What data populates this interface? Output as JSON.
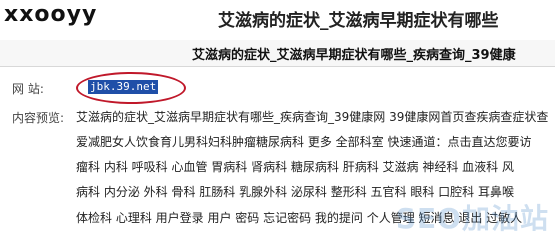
{
  "header": {
    "logo": "xxooyy",
    "title": "艾滋病的症状_艾滋病早期症状有哪些"
  },
  "result": {
    "title": "艾滋病的症状_艾滋病早期症状有哪些_疾病查询_39健康",
    "site_label": "网      站:",
    "site_value": "jbk.39.net",
    "preview_label": "内容预览:",
    "preview_lines": [
      "艾滋病的症状_艾滋病早期症状有哪些_疾病查询_39健康网 39健康网首页查疾病查症状查",
      "爱减肥女人饮食育儿男科妇科肿瘤糖尿病科 更多 全部科室 快速通道：点击直达您要访",
      "瘤科 内科 呼吸科 心血管 胃病科 肾病科 糖尿病科 肝病科 艾滋病 神经科 血液科 风",
      "病科 内分泌 外科 骨科 肛肠科 乳腺外科 泌尿科 整形科 五官科 眼科 口腔科 耳鼻喉",
      "体检科 心理科 用户登录 用户 密码 忘记密码 我的提问 个人管理 短消息 退出 过敏人"
    ]
  },
  "watermark": "SEO加油站",
  "colors": {
    "highlight_bg": "#1f4fa8",
    "circle": "#c0182a"
  }
}
